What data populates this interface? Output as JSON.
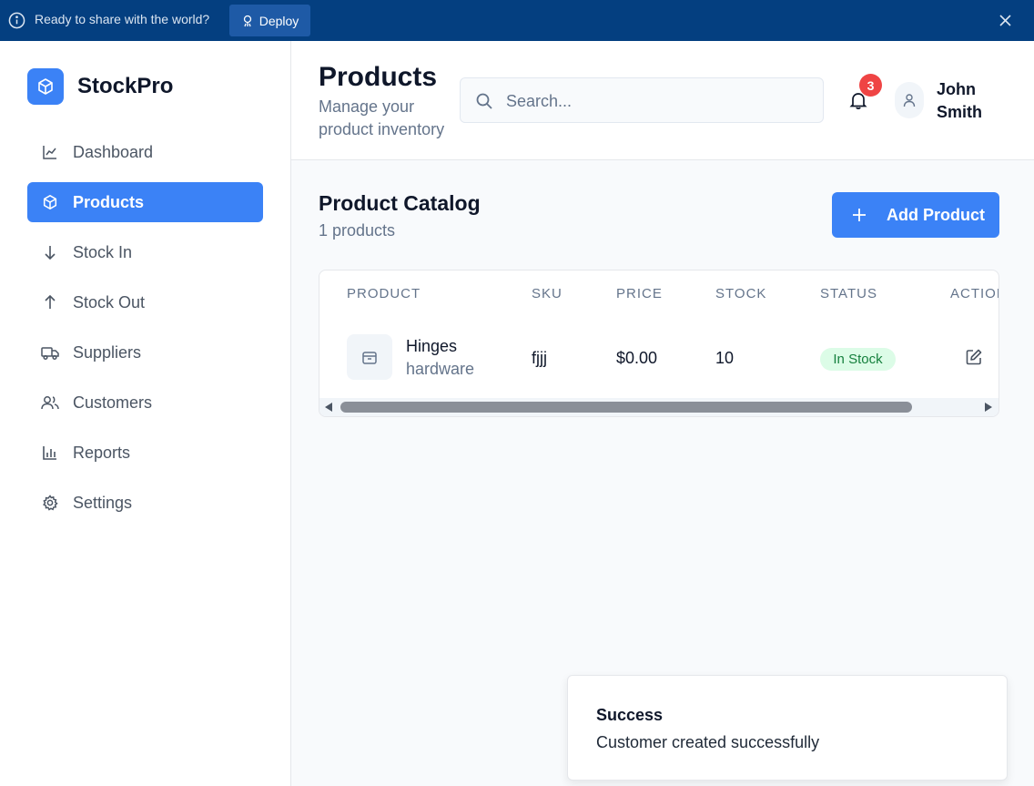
{
  "banner": {
    "message": "Ready to share with the world?",
    "deploy_label": "Deploy"
  },
  "brand": {
    "name": "StockPro"
  },
  "sidebar": {
    "items": [
      {
        "label": "Dashboard",
        "icon": "chart-line-icon",
        "active": false
      },
      {
        "label": "Products",
        "icon": "box-icon",
        "active": true
      },
      {
        "label": "Stock In",
        "icon": "arrow-down-icon",
        "active": false
      },
      {
        "label": "Stock Out",
        "icon": "arrow-up-icon",
        "active": false
      },
      {
        "label": "Suppliers",
        "icon": "truck-icon",
        "active": false
      },
      {
        "label": "Customers",
        "icon": "users-icon",
        "active": false
      },
      {
        "label": "Reports",
        "icon": "bar-chart-icon",
        "active": false
      },
      {
        "label": "Settings",
        "icon": "gear-icon",
        "active": false
      }
    ]
  },
  "header": {
    "title": "Products",
    "subtitle": "Manage your product inventory",
    "search_placeholder": "Search...",
    "notification_count": "3",
    "user_name": "John Smith"
  },
  "catalog": {
    "title": "Product Catalog",
    "count": "1 products",
    "add_label": "Add Product"
  },
  "table": {
    "columns": [
      "PRODUCT",
      "SKU",
      "PRICE",
      "STOCK",
      "STATUS",
      "ACTIONS"
    ],
    "rows": [
      {
        "name": "Hinges",
        "category": "hardware",
        "sku": "fjjj",
        "price": "$0.00",
        "stock": "10",
        "status": "In Stock"
      }
    ]
  },
  "toast": {
    "title": "Success",
    "message": "Customer created successfully"
  },
  "colors": {
    "banner": "#043f80",
    "accent": "#3b82f6",
    "badge": "#ef4444",
    "status_bg": "#dcfce7",
    "status_text": "#15803d"
  }
}
